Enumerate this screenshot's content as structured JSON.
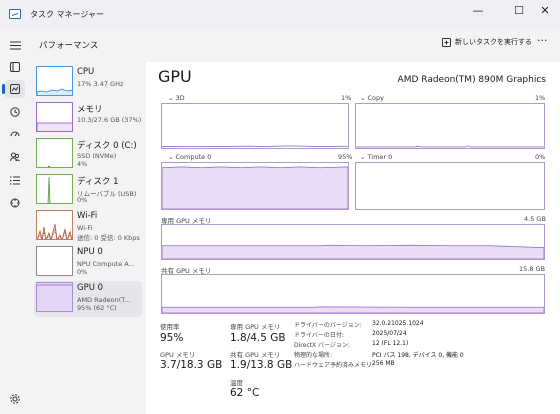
{
  "window": {
    "title": "タスク マネージャー",
    "minimize": "—",
    "maximize": "☐",
    "close": "✕"
  },
  "header": {
    "title": "パフォーマンス",
    "run_task": "新しいタスクを実行する",
    "more": "···"
  },
  "rail": {
    "icons": [
      "hamburger-icon",
      "processes-icon",
      "performance-icon",
      "app-history-icon",
      "startup-icon",
      "users-icon",
      "details-icon",
      "services-icon",
      "settings-icon"
    ]
  },
  "list": [
    {
      "name": "CPU",
      "sub1": "17%  3.47 GHz",
      "sub2": ""
    },
    {
      "name": "メモリ",
      "sub1": "10.3/27.6 GB (37%)",
      "sub2": ""
    },
    {
      "name": "ディスク 0 (C:)",
      "sub1": "SSD (NVMe)",
      "sub2": "4%"
    },
    {
      "name": "ディスク 1",
      "sub1": "リムーバブル (USB)",
      "sub2": "0%"
    },
    {
      "name": "Wi-Fi",
      "sub1": "Wi-Fi",
      "sub2": "送信: 0 受信: 0 Kbps"
    },
    {
      "name": "NPU 0",
      "sub1": "NPU Compute A...",
      "sub2": "0%"
    },
    {
      "name": "GPU 0",
      "sub1": "AMD Radeon(T...",
      "sub2": "95% (62 °C)"
    }
  ],
  "main": {
    "title": "GPU",
    "model": "AMD Radeon(TM) 890M Graphics",
    "graphs": {
      "g3d": {
        "label": "3D",
        "pct": "1%",
        "level": 0.01
      },
      "copy": {
        "label": "Copy",
        "pct": "1%",
        "level": 0.01
      },
      "compute": {
        "label": "Compute 0",
        "pct": "95%",
        "level": 0.95
      },
      "timer": {
        "label": "Timer 0",
        "pct": "0%",
        "level": 0.0
      },
      "dedicated": {
        "label": "専用 GPU メモリ",
        "max": "4.5 GB",
        "level": 0.4
      },
      "shared": {
        "label": "共有 GPU メモリ",
        "max": "15.8 GB",
        "level": 0.14
      }
    },
    "stats": {
      "usage_label": "使用率",
      "usage_value": "95%",
      "dedicated_label": "専用 GPU メモリ",
      "dedicated_value": "1.8/4.5 GB",
      "gpu_mem_label": "GPU メモリ",
      "gpu_mem_value": "3.7/18.3 GB",
      "shared_label": "共有 GPU メモリ",
      "shared_value": "1.9/13.8 GB",
      "temp_label": "温度",
      "temp_value": "62 °C"
    },
    "info": [
      {
        "k": "ドライバーのバージョン:",
        "v": "32.0.21025.1024"
      },
      {
        "k": "ドライバーの日付:",
        "v": "2025/07/24"
      },
      {
        "k": "DirectX バージョン:",
        "v": "12 (FL 12.1)"
      },
      {
        "k": "物理的な場所:",
        "v": "PCI バス 198, デバイス 0, 機能 0"
      },
      {
        "k": "ハードウェア予約済みメモリ:",
        "v": "256 MB"
      }
    ]
  },
  "colors": {
    "gpu_line": "#8e63c4",
    "gpu_fill": "#e9def6",
    "cpu_line": "#1a87d6",
    "memory_line": "#8b4fb3",
    "disk_line": "#4f9d35",
    "wifi_line": "#a05a2c"
  }
}
